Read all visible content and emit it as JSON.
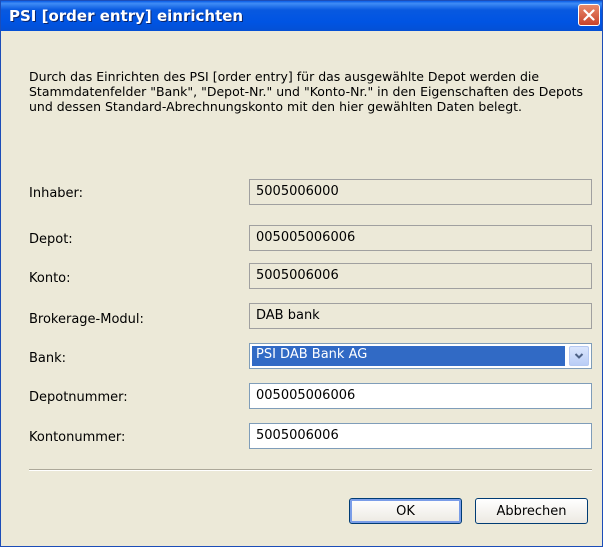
{
  "dialog": {
    "title": "PSI [order entry] einrichten",
    "description": "Durch das Einrichten des PSI [order entry] für das ausgewählte Depot werden die Stammdatenfelder \"Bank\", \"Depot-Nr.\" und \"Konto-Nr.\" in den Eigenschaften des Depots und dessen Standard-Abrechnungskonto mit den hier gewählten Daten belegt."
  },
  "fields": {
    "inhaber": {
      "label": "Inhaber:",
      "value": "5005006000"
    },
    "depot": {
      "label": "Depot:",
      "value": "005005006006"
    },
    "konto": {
      "label": "Konto:",
      "value": "5005006006"
    },
    "brokerage": {
      "label": "Brokerage-Modul:",
      "value": "DAB bank"
    },
    "bank": {
      "label": "Bank:",
      "value": "PSI DAB Bank AG"
    },
    "depotnummer": {
      "label": "Depotnummer:",
      "value": "005005006006"
    },
    "kontonummer": {
      "label": "Kontonummer:",
      "value": "5005006006"
    }
  },
  "buttons": {
    "ok": "OK",
    "cancel": "Abbrechen"
  },
  "icons": {
    "close": "close-icon",
    "dropdown": "chevron-down-icon"
  },
  "colors": {
    "titlebar": "#0054e3",
    "close_button": "#c8432a",
    "selection": "#316ac5",
    "dialog_bg": "#ece9d8"
  }
}
